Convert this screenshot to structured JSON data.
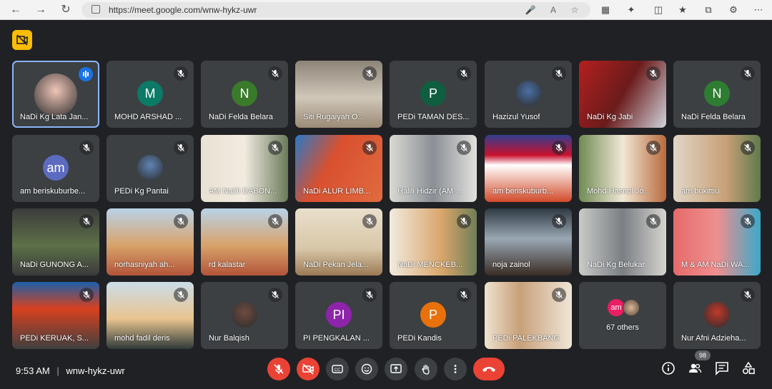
{
  "browser": {
    "url": "https://meet.google.com/wnw-hykz-uwr"
  },
  "tiles": [
    {
      "name": "NaDi Kg Lata Jan..."
    },
    {
      "name": "MOHD ARSHAD ...",
      "initial": "M"
    },
    {
      "name": "NaDi Felda Belara",
      "initial": "N"
    },
    {
      "name": "Siti Rugaiyah O..."
    },
    {
      "name": "PEDi TAMAN DES...",
      "initial": "P"
    },
    {
      "name": "Hazizul Yusof"
    },
    {
      "name": "NaDi Kg Jabi"
    },
    {
      "name": "NaDi Felda Belara",
      "initial": "N"
    },
    {
      "name": "am beriskuburbe...",
      "initial": "am"
    },
    {
      "name": "PEDi Kg Pantai"
    },
    {
      "name": "AM NaDi DABON..."
    },
    {
      "name": "NaDi ALUR LIMB..."
    },
    {
      "name": "Halili Hidzir (AM ..."
    },
    {
      "name": "am beriskuburb..."
    },
    {
      "name": "Mohd Hasnol Jo..."
    },
    {
      "name": "am bukittiu"
    },
    {
      "name": "NaDi GUNONG A..."
    },
    {
      "name": "norhasniyah ah..."
    },
    {
      "name": "rd kalastar"
    },
    {
      "name": "NaDi Pekan Jela..."
    },
    {
      "name": "NaDi MENCKEB..."
    },
    {
      "name": "noja zainol"
    },
    {
      "name": "NaDi Kg Belukar"
    },
    {
      "name": "M & AM NaDi WA..."
    },
    {
      "name": "PEDi KERUAK, S..."
    },
    {
      "name": "mohd fadil deris"
    },
    {
      "name": "Nur Balqish"
    },
    {
      "name": "PI PENGKALAN ...",
      "initial": "PI"
    },
    {
      "name": "PEDi Kandis",
      "initial": "P"
    },
    {
      "name": "PEDi PALEKBANG"
    },
    {
      "name": "67 others",
      "mini_initial": "am"
    },
    {
      "name": "Nur Afni Adzieha..."
    }
  ],
  "footer": {
    "time": "9:53 AM",
    "meeting_code": "wnw-hykz-uwr",
    "participants_count": "98"
  },
  "colors": {
    "accent": "#8ab4f8",
    "danger": "#ea4335",
    "badge": "#fbbc04"
  }
}
